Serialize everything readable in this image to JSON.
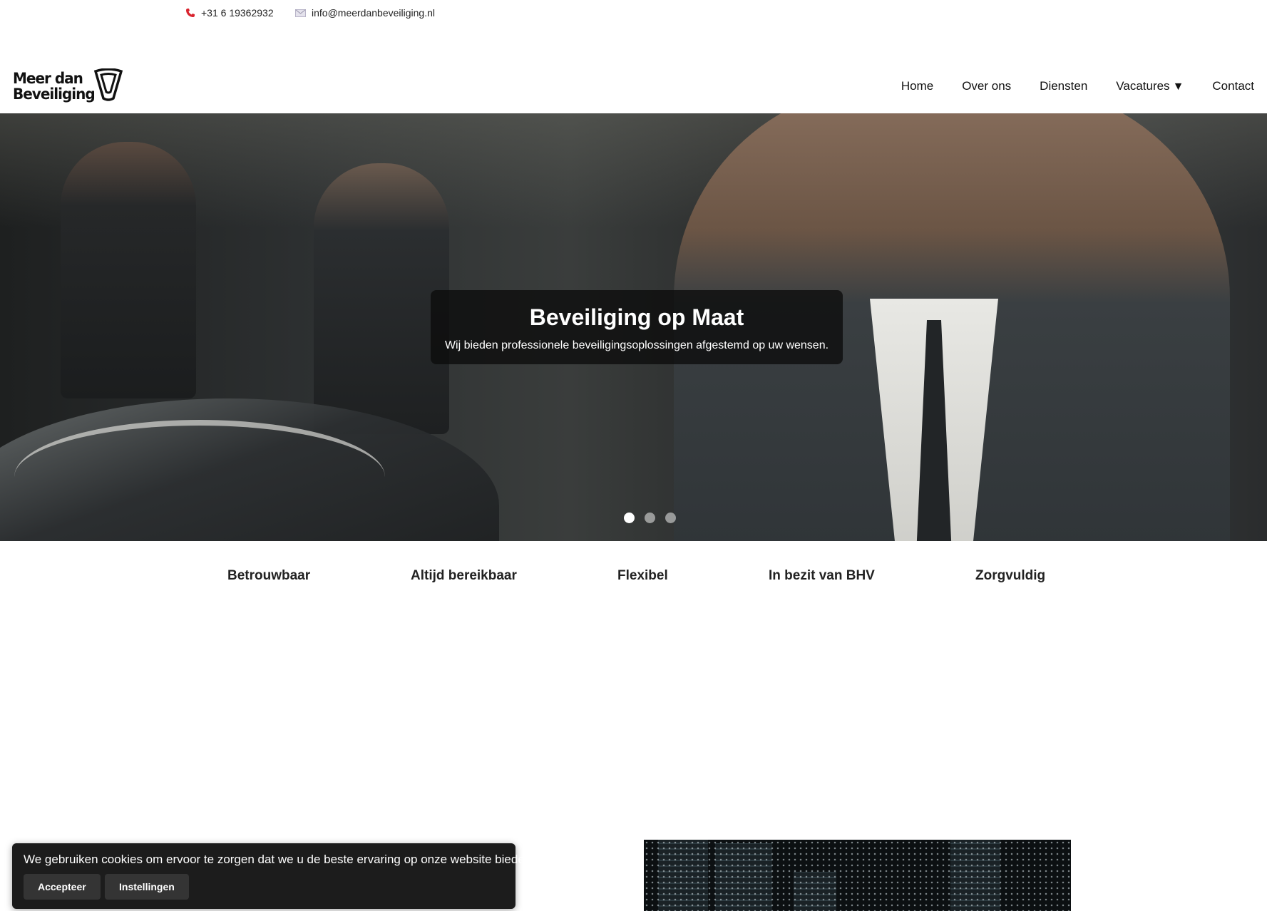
{
  "topbar": {
    "phone": "+31 6 19362932",
    "email": "info@meerdanbeveiliging.nl",
    "phone_icon": "phone-icon",
    "email_icon": "mail-icon"
  },
  "logo": {
    "line1": "Meer dan",
    "line2": "Beveiliging",
    "icon": "shield-icon"
  },
  "nav": {
    "items": [
      "Home",
      "Over ons",
      "Diensten",
      "Vacatures",
      "Contact"
    ],
    "dropdown_caret": "▼"
  },
  "hero": {
    "title": "Beveiliging op Maat",
    "subtitle": "Wij bieden professionele beveiligingsoplossingen afgestemd op uw wensen.",
    "slides_total": 3,
    "active_slide": 1
  },
  "features": [
    "Betrouwbaar",
    "Altijd bereikbaar",
    "Flexibel",
    "In bezit van BHV",
    "Zorgvuldig"
  ],
  "cookie": {
    "message": "We gebruiken cookies om ervoor te zorgen dat we u de beste ervaring op onze website bieden.",
    "accept_label": "Accepteer",
    "settings_label": "Instellingen"
  },
  "colors": {
    "phone_icon": "#d9232e",
    "cookie_bg": "#1c1c1c",
    "button_bg": "#343434"
  }
}
